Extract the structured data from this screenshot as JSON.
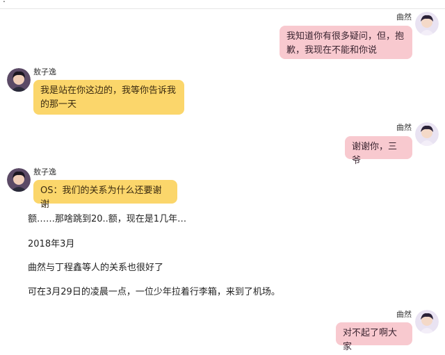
{
  "topbar": {
    "fragment": "."
  },
  "participants": {
    "right_name": "曲然",
    "left_name": "敖子逸"
  },
  "messages": [
    {
      "side": "right",
      "name": "曲然",
      "text": "我知道你有很多疑问，但，抱歉，我现在不能和你说"
    },
    {
      "side": "left",
      "name": "敖子逸",
      "text": "我是站在你这边的，我等你告诉我的那一天"
    },
    {
      "side": "right",
      "name": "曲然",
      "text": "谢谢你，三爷"
    },
    {
      "side": "left",
      "name": "敖子逸",
      "text": "OS：我们的关系为什么还要谢谢"
    },
    {
      "side": "right",
      "name": "曲然",
      "text": "对不起了啊大家"
    }
  ],
  "narration": [
    "额……那啥跳到20..额，现在是1几年…",
    "2018年3月",
    "曲然与丁程鑫等人的关系也很好了",
    "可在3月29日的凌晨一点，一位少年拉着行李箱，来到了机场。"
  ],
  "colors": {
    "right_bubble": "#f8c9cf",
    "left_bubble": "#fbd66b",
    "background": "#ffffff"
  },
  "icons": {
    "right_avatar": "avatar-qu-ran",
    "left_avatar": "avatar-ao-ziyi"
  }
}
